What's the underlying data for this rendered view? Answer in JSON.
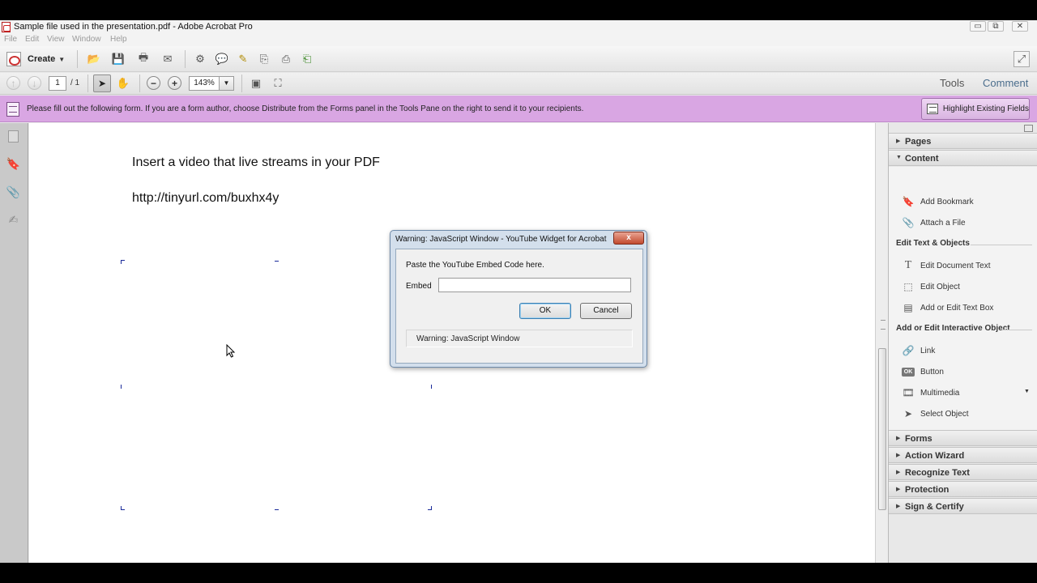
{
  "window": {
    "title": "Sample file used in the presentation.pdf - Adobe Acrobat Pro",
    "minimize": "▭",
    "restore": "⧉",
    "close": "✕"
  },
  "menubar": [
    "File",
    "Edit",
    "View",
    "Window",
    "Help"
  ],
  "toolbar": {
    "create_label": "Create",
    "page_current": "1",
    "page_total": "/ 1",
    "zoom": "143%",
    "tools_tab": "Tools",
    "comment_tab": "Comment"
  },
  "formbar": {
    "message": "Please fill out the following form. If you are a form author, choose Distribute from the Forms panel in the Tools Pane on the right to send it to your recipients.",
    "highlight_label": "Highlight Existing Fields"
  },
  "document": {
    "line1": "Insert a video that live streams in your PDF",
    "line2": "http://tinyurl.com/buxhx4y"
  },
  "rightpane": {
    "pages": "Pages",
    "content": "Content",
    "content_items": [
      {
        "label": "Add Bookmark",
        "icon": "bookmark-icon"
      },
      {
        "label": "Attach a File",
        "icon": "paperclip-icon"
      }
    ],
    "group_edit_text": "Edit Text & Objects",
    "edit_items": [
      {
        "label": "Edit Document Text",
        "icon": "text-edit-icon"
      },
      {
        "label": "Edit Object",
        "icon": "edit-object-icon"
      },
      {
        "label": "Add or Edit Text Box",
        "icon": "textbox-icon"
      }
    ],
    "group_interactive": "Add or Edit Interactive Object",
    "interactive_items": [
      {
        "label": "Link",
        "icon": "link-icon"
      },
      {
        "label": "Button",
        "icon": "ok-button-icon"
      },
      {
        "label": "Multimedia",
        "icon": "multimedia-icon"
      },
      {
        "label": "Select Object",
        "icon": "arrow-select-icon"
      }
    ],
    "sections": [
      "Forms",
      "Action Wizard",
      "Recognize Text",
      "Protection",
      "Sign & Certify"
    ]
  },
  "dialog": {
    "title": "Warning: JavaScript Window - YouTube Widget for Acrobat",
    "close": "x",
    "prompt": "Paste the YouTube Embed Code here.",
    "embed_label": "Embed",
    "embed_value": "",
    "ok_label": "OK",
    "cancel_label": "Cancel",
    "status": "Warning: JavaScript Window"
  }
}
